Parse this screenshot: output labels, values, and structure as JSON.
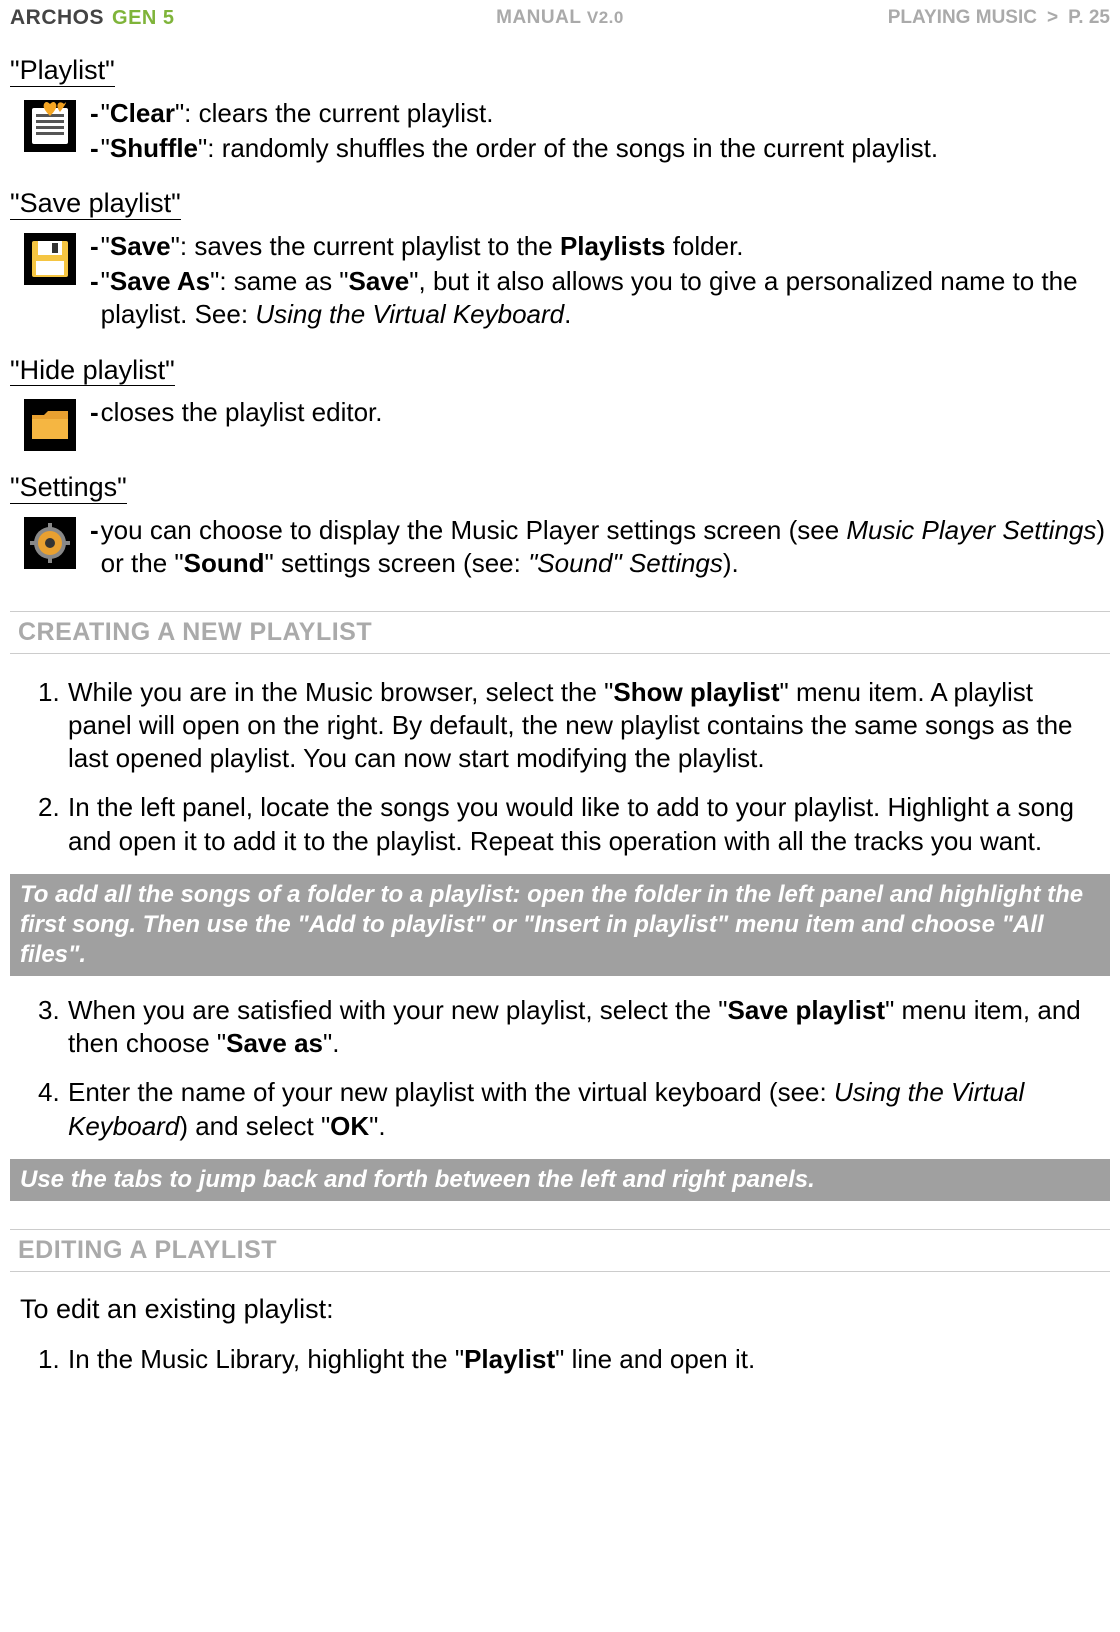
{
  "header": {
    "brand": "ARCHOS",
    "gen": "GEN 5",
    "manual_label": "MANUAL",
    "manual_version": "V2.0",
    "breadcrumb": "PLAYING MUSIC",
    "sep": ">",
    "page": "P. 25"
  },
  "menus": [
    {
      "heading": "\"Playlist\"",
      "icon": "heart-list-icon",
      "items": [
        {
          "bold_label": "Clear",
          "text": "\": clears the current playlist."
        },
        {
          "bold_label": "Shuffle",
          "text": "\": randomly shuffles the order of the songs in the current playlist."
        }
      ]
    },
    {
      "heading": "\"Save playlist\"",
      "icon": "save-disk-icon",
      "items": [
        {
          "bold_label": "Save",
          "text_pre": "\": saves the current playlist to the ",
          "bold_inline": "Playlists",
          "text_post": " folder."
        },
        {
          "bold_label": "Save As",
          "text_pre": "\": same as \"",
          "bold_inline": "Save",
          "text_post": "\", but it also allows you to give a personalized name to the playlist. See: ",
          "italic_link": "Using the Virtual Keyboard",
          "text_end": "."
        }
      ]
    },
    {
      "heading": "\"Hide playlist\"",
      "icon": "folder-icon",
      "items": [
        {
          "plain": "closes the playlist editor."
        }
      ]
    },
    {
      "heading": "\"Settings\"",
      "icon": "gear-icon",
      "items": [
        {
          "settings_pre": "you can choose to display the Music Player settings screen (see ",
          "settings_link1": "Music Player Settings",
          "settings_mid": ") or the \"",
          "settings_bold": "Sound",
          "settings_mid2": "\" settings screen (see: ",
          "settings_link2": "\"Sound\" Settings",
          "settings_end": ")."
        }
      ]
    }
  ],
  "section_creating": {
    "title": "CREATING A NEW PLAYLIST",
    "steps": [
      {
        "num": "1.",
        "pre": "While you are in the Music browser, select the \"",
        "bold": "Show playlist",
        "post": "\" menu item. A playlist panel will open on the right. By default, the new playlist contains the same songs as the last opened playlist. You can now start modifying the playlist."
      },
      {
        "num": "2.",
        "pre": "In the left panel, locate the songs you would like to add to your playlist. Highlight a song and open it to add it to the playlist. Repeat this operation with all the tracks you want.",
        "bold": "",
        "post": ""
      }
    ],
    "tip1": "To add all the songs of a folder to a playlist: open the folder in the left panel and highlight the first song. Then use the \"Add to playlist\" or \"Insert in playlist\" menu item and choose \"All files\".",
    "steps2": [
      {
        "num": "3.",
        "pre": "When you are satisfied with your new playlist, select the \"",
        "bold": "Save playlist",
        "post": "\" menu item, and then choose \"",
        "bold2": "Save as",
        "post2": "\"."
      },
      {
        "num": "4.",
        "pre": "Enter the name of your new playlist with the virtual keyboard (see: ",
        "italic": "Using the Virtual Keyboard",
        "mid": ") and select \"",
        "bold": "OK",
        "post": "\"."
      }
    ],
    "tip2": "Use the tabs to jump back and forth between the left and right panels."
  },
  "section_editing": {
    "title": "EDITING A PLAYLIST",
    "intro": "To edit an existing playlist:",
    "steps": [
      {
        "num": "1.",
        "pre": "In the Music Library, highlight the \"",
        "bold": "Playlist",
        "post": "\" line and open it."
      }
    ]
  }
}
